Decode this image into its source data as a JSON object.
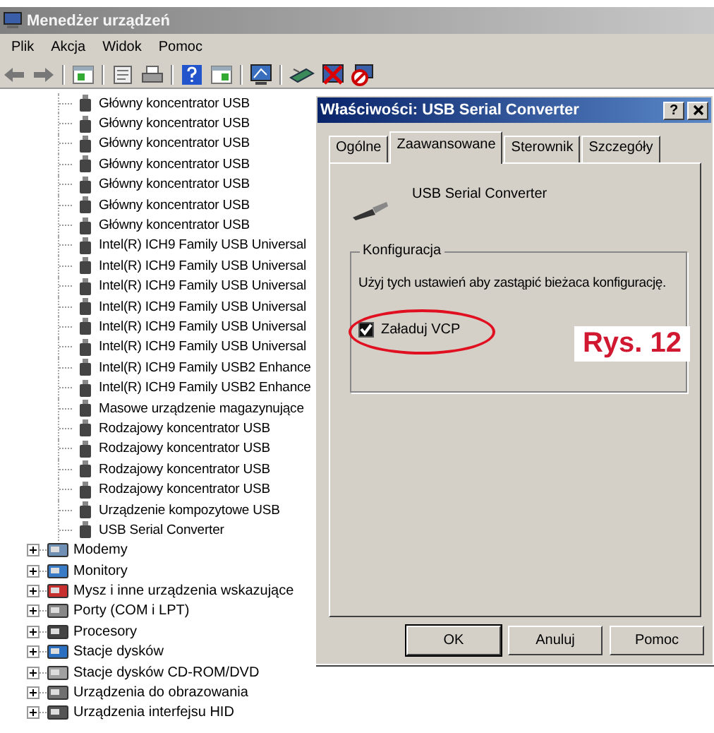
{
  "window": {
    "title": "Menedżer urządzeń"
  },
  "menu": [
    "Plik",
    "Akcja",
    "Widok",
    "Pomoc"
  ],
  "usb_devices": [
    "Główny koncentrator USB",
    "Główny koncentrator USB",
    "Główny koncentrator USB",
    "Główny koncentrator USB",
    "Główny koncentrator USB",
    "Główny koncentrator USB",
    "Główny koncentrator USB",
    "Intel(R) ICH9 Family USB Universal",
    "Intel(R) ICH9 Family USB Universal",
    "Intel(R) ICH9 Family USB Universal",
    "Intel(R) ICH9 Family USB Universal",
    "Intel(R) ICH9 Family USB Universal",
    "Intel(R) ICH9 Family USB Universal",
    "Intel(R) ICH9 Family USB2 Enhance",
    "Intel(R) ICH9 Family USB2 Enhance",
    "Masowe urządzenie magazynujące",
    "Rodzajowy koncentrator USB",
    "Rodzajowy koncentrator USB",
    "Rodzajowy koncentrator USB",
    "Rodzajowy koncentrator USB",
    "Urządzenie kompozytowe USB",
    "USB Serial Converter"
  ],
  "categories": [
    {
      "label": "Modemy",
      "kind": "modem",
      "expanded": false
    },
    {
      "label": "Monitory",
      "kind": "monitor",
      "expanded": false
    },
    {
      "label": "Mysz i inne urządzenia wskazujące",
      "kind": "mouse",
      "expanded": false
    },
    {
      "label": "Porty (COM i LPT)",
      "kind": "port",
      "expanded": false
    },
    {
      "label": "Procesory",
      "kind": "cpu",
      "expanded": false
    },
    {
      "label": "Stacje dysków",
      "kind": "disk",
      "expanded": false
    },
    {
      "label": "Stacje dysków CD-ROM/DVD",
      "kind": "cdrom",
      "expanded": false
    },
    {
      "label": "Urządzenia do obrazowania",
      "kind": "imaging",
      "expanded": false
    },
    {
      "label": "Urządzenia interfejsu HID",
      "kind": "hid",
      "expanded": false
    }
  ],
  "dialog": {
    "title": "Właściwości: USB Serial Converter",
    "help_button": "?",
    "tabs": [
      {
        "label": "Ogólne",
        "selected": false
      },
      {
        "label": "Zaawansowane",
        "selected": true
      },
      {
        "label": "Sterownik",
        "selected": false
      },
      {
        "label": "Szczegóły",
        "selected": false
      }
    ],
    "device_name": "USB Serial Converter",
    "group": {
      "title": "Konfiguracja",
      "description": "Użyj tych ustawień aby zastąpić bieżaca konfigurację.",
      "checkbox": {
        "label": "Załaduj VCP",
        "checked": true
      }
    },
    "buttons": [
      {
        "label": "OK",
        "default": true
      },
      {
        "label": "Anuluj",
        "default": false
      },
      {
        "label": "Pomoc",
        "default": false
      }
    ]
  },
  "annotation": {
    "label": "Rys. 12"
  }
}
